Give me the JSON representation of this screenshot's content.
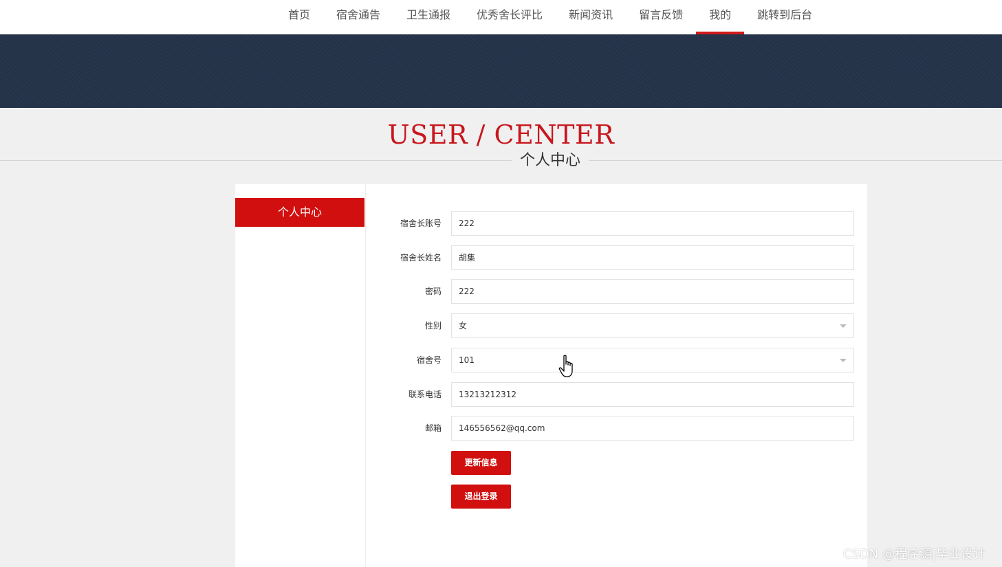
{
  "nav": {
    "items": [
      {
        "label": "首页"
      },
      {
        "label": "宿舍通告"
      },
      {
        "label": "卫生通报"
      },
      {
        "label": "优秀舍长评比"
      },
      {
        "label": "新闻资讯"
      },
      {
        "label": "留言反馈"
      },
      {
        "label": "我的"
      },
      {
        "label": "跳转到后台"
      }
    ],
    "active_index": 6
  },
  "heading": {
    "en": "USER / CENTER",
    "cn": "个人中心"
  },
  "sidebar": {
    "items": [
      {
        "label": "个人中心"
      }
    ]
  },
  "form": {
    "fields": [
      {
        "label": "宿舍长账号",
        "value": "222"
      },
      {
        "label": "宿舍长姓名",
        "value": "胡集"
      },
      {
        "label": "密码",
        "value": "222"
      },
      {
        "label": "性别",
        "value": "女"
      },
      {
        "label": "宿舍号",
        "value": "101"
      },
      {
        "label": "联系电话",
        "value": "13213212312"
      },
      {
        "label": "邮箱",
        "value": "146556562@qq.com"
      }
    ],
    "update_button": "更新信息",
    "logout_button": "退出登录"
  },
  "colors": {
    "accent": "#d10f0f",
    "banner": "#243249"
  },
  "watermark": "CSDN @程序源|毕业设计"
}
